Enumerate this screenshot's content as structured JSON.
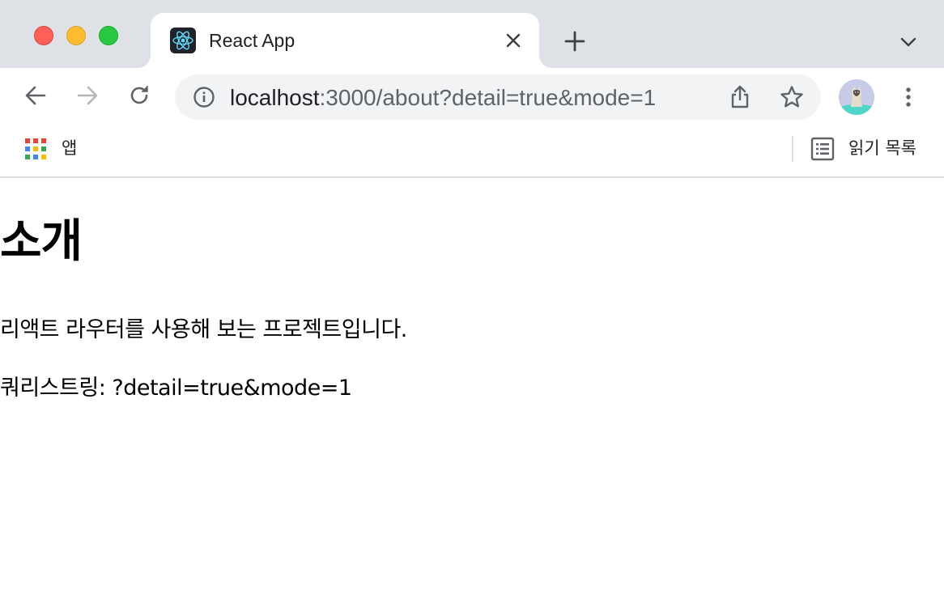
{
  "window": {
    "traffic_lights": [
      "close",
      "minimize",
      "zoom"
    ]
  },
  "tab": {
    "title": "React App",
    "favicon": "react-logo-icon"
  },
  "toolbar": {
    "url_host": "localhost",
    "url_rest": ":3000/about?detail=true&mode=1"
  },
  "bookmarks": {
    "apps_label": "앱",
    "reading_list_label": "읽기 목록"
  },
  "page": {
    "title": "소개",
    "description": "리액트 라우터를 사용해 보는 프로젝트입니다.",
    "query_label": "쿼리스트링:",
    "query_value": "?detail=true&mode=1"
  },
  "colors": {
    "tabstrip_bg": "#dee1e6",
    "omnibox_bg": "#f1f3f4",
    "traffic_red": "#fe5f57",
    "traffic_yellow": "#febc2e",
    "traffic_green": "#28c840",
    "react_blue": "#61dafb"
  }
}
